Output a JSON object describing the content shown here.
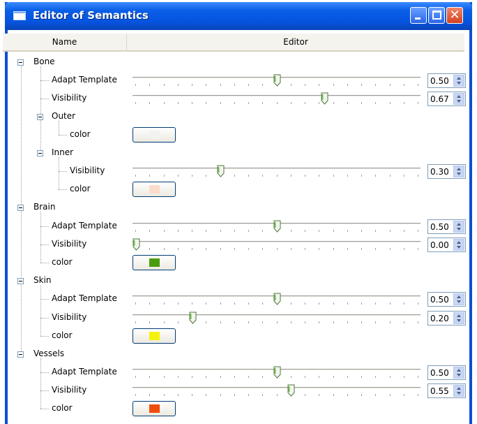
{
  "window": {
    "title": "Editor of Semantics",
    "icon": "window-app-icon",
    "controls": [
      "minimize-icon",
      "maximize-icon",
      "close-icon"
    ]
  },
  "header": {
    "name": "Name",
    "editor": "Editor"
  },
  "groups": [
    {
      "label": "Bone",
      "adapt_label": "Adapt Template",
      "adapt_value": "0.50",
      "adapt_fraction": 0.5,
      "visibility_label": "Visibility",
      "visibility_value": "0.67",
      "visibility_fraction": 0.67,
      "outer": {
        "label": "Outer",
        "color_label": "color",
        "color": "#f2f2f2"
      },
      "inner": {
        "label": "Inner",
        "visibility_label": "Visibility",
        "visibility_value": "0.30",
        "visibility_fraction": 0.3,
        "color_label": "color",
        "color": "#fbdccb"
      }
    },
    {
      "label": "Brain",
      "adapt_label": "Adapt Template",
      "adapt_value": "0.50",
      "adapt_fraction": 0.5,
      "visibility_label": "Visibility",
      "visibility_value": "0.00",
      "visibility_fraction": 0.0,
      "color_label": "color",
      "color": "#4a9c0e"
    },
    {
      "label": "Skin",
      "adapt_label": "Adapt Template",
      "adapt_value": "0.50",
      "adapt_fraction": 0.5,
      "visibility_label": "Visibility",
      "visibility_value": "0.20",
      "visibility_fraction": 0.2,
      "color_label": "color",
      "color": "#f6f20c"
    },
    {
      "label": "Vessels",
      "adapt_label": "Adapt Template",
      "adapt_value": "0.50",
      "adapt_fraction": 0.5,
      "visibility_label": "Visibility",
      "visibility_value": "0.55",
      "visibility_fraction": 0.55,
      "color_label": "color",
      "color": "#ef4d0c"
    }
  ]
}
